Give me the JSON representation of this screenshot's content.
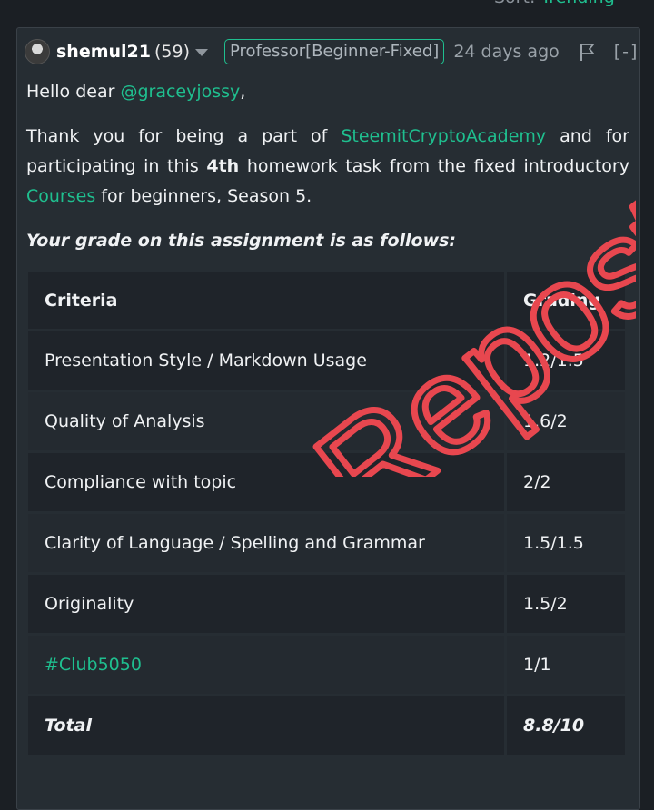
{
  "sort": {
    "label": "Sort:",
    "value": "Trending"
  },
  "comment": {
    "author": "shemul21",
    "reputation": "(59)",
    "role_badge": "Professor[Beginner-Fixed]",
    "time": "24 days ago",
    "collapse": "[-]",
    "greeting_prefix": "Hello dear ",
    "mention": "@graceyjossy",
    "greeting_suffix": ",",
    "thanks_1": "Thank you for being a part of ",
    "academy_link": "SteemitCryptoAcademy",
    "thanks_2": " and for participating in this ",
    "task_ordinal": "4th",
    "thanks_3": " homework task from the fixed introductory ",
    "courses_link": "Courses",
    "thanks_4": " for beginners, Season 5.",
    "grade_intro": "Your grade on this assignment is as follows:"
  },
  "grade_table": {
    "headers": [
      "Criteria",
      "Grading"
    ],
    "rows": [
      {
        "criteria": "Presentation Style / Markdown Usage",
        "grade": "1.2/1.5"
      },
      {
        "criteria": "Quality of Analysis",
        "grade": "1.6/2"
      },
      {
        "criteria": "Compliance with topic",
        "grade": "2/2"
      },
      {
        "criteria": "Clarity of Language / Spelling and Grammar",
        "grade": "1.5/1.5"
      },
      {
        "criteria": "Originality",
        "grade": "1.5/2"
      },
      {
        "criteria": "#Club5050",
        "grade": "1/1"
      }
    ],
    "total": {
      "criteria": "Total",
      "grade": "8.8/10"
    }
  },
  "watermark": {
    "text": "Repost",
    "color": "#e8474f"
  },
  "colors": {
    "accent": "#1fbf8f",
    "background": "#1b1f24",
    "card": "#262d33"
  }
}
